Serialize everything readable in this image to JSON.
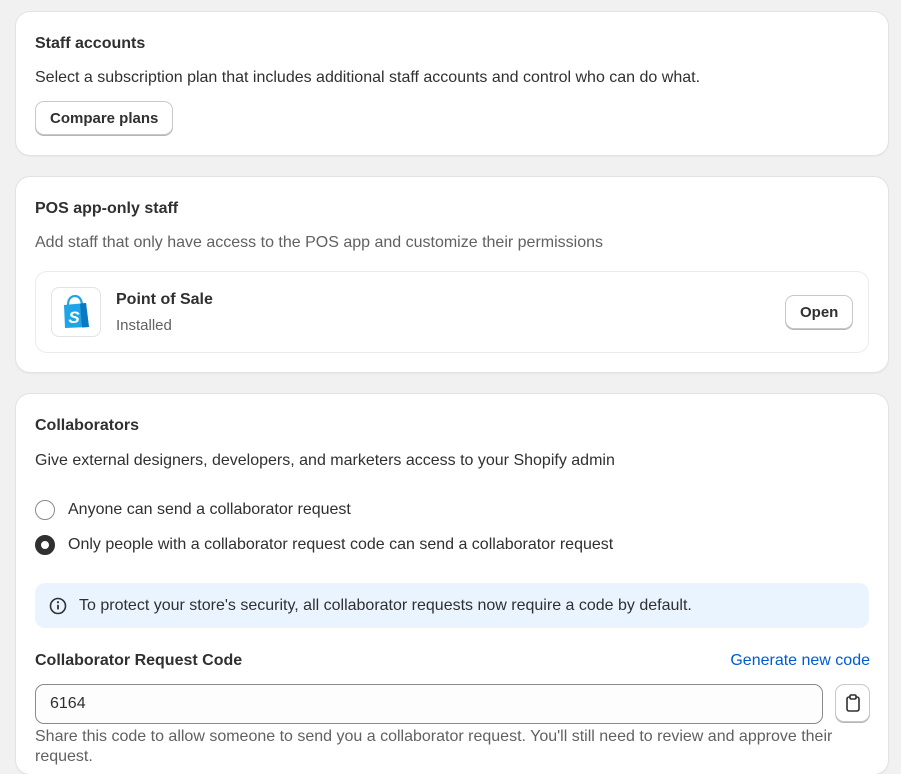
{
  "staff_accounts": {
    "title": "Staff accounts",
    "description": "Select a subscription plan that includes additional staff accounts and control who can do what.",
    "compare_plans_label": "Compare plans"
  },
  "pos_staff": {
    "title": "POS app-only staff",
    "description": "Add staff that only have access to the POS app and customize their permissions",
    "app": {
      "icon": "shopify-bag-icon",
      "name": "Point of Sale",
      "status": "Installed",
      "open_label": "Open"
    }
  },
  "collaborators": {
    "title": "Collaborators",
    "description": "Give external designers, developers, and marketers access to your Shopify admin",
    "options": [
      {
        "label": "Anyone can send a collaborator request",
        "checked": false
      },
      {
        "label": "Only people with a collaborator request code can send a collaborator request",
        "checked": true
      }
    ],
    "banner": {
      "icon": "info-icon",
      "text": "To protect your store's security, all collaborator requests now require a code by default."
    },
    "code_label": "Collaborator Request Code",
    "generate_label": "Generate new code",
    "code_value": "6164",
    "copy_icon": "clipboard-icon",
    "help_text": "Share this code to allow someone to send you a collaborator request. You'll still need to review and approve their request."
  },
  "colors": {
    "page_bg": "#f1f1f1",
    "card_bg": "#ffffff",
    "link": "#005bd3",
    "banner_bg": "#eaf4ff",
    "shopify_blue": "#1fa5e6"
  }
}
